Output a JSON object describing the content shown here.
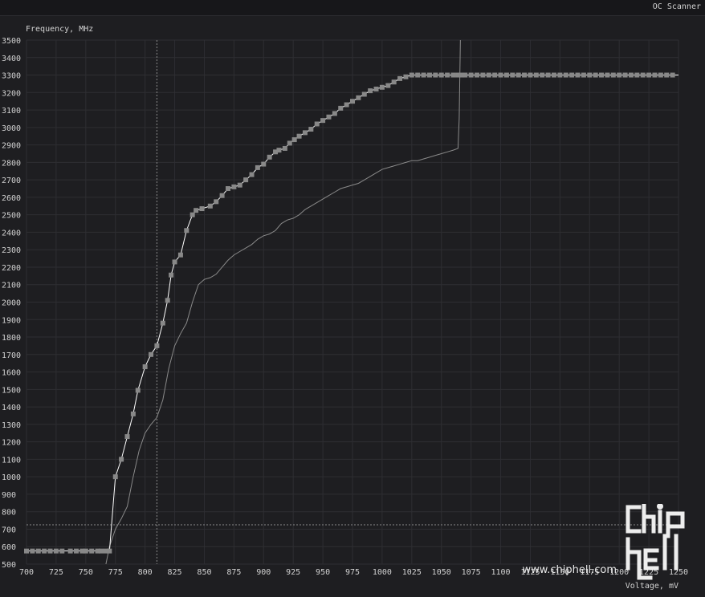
{
  "window": {
    "title": "OC Scanner"
  },
  "watermark": {
    "url": "www.chiphell.com"
  },
  "chart_data": {
    "type": "line",
    "ylabel": "Frequency, MHz",
    "xlabel": "Voltage, mV",
    "xlim": [
      700,
      1250
    ],
    "ylim": [
      500,
      3500
    ],
    "x_ticks": [
      700,
      725,
      750,
      775,
      800,
      825,
      850,
      875,
      900,
      925,
      950,
      975,
      1000,
      1025,
      1050,
      1075,
      1100,
      1125,
      1150,
      1175,
      1200,
      1225,
      1250
    ],
    "y_ticks": [
      500,
      600,
      700,
      800,
      900,
      1000,
      1100,
      1200,
      1300,
      1400,
      1500,
      1600,
      1700,
      1800,
      1900,
      2000,
      2100,
      2200,
      2300,
      2400,
      2500,
      2600,
      2700,
      2800,
      2900,
      3000,
      3100,
      3200,
      3300,
      3400,
      3500
    ],
    "grid": true,
    "crosshair": {
      "x": 810,
      "y": 725
    },
    "colors": {
      "curve": "#ffffff",
      "point": "#888888",
      "baseline": "#8a8a8a",
      "grid": "#2e2e32",
      "text": "#d2d2d2"
    },
    "series": [
      {
        "style": "line-with-markers",
        "x": [
          700,
          705,
          710,
          715,
          720,
          725,
          730,
          737,
          742,
          747,
          750,
          755,
          760,
          763,
          767,
          770,
          775,
          780,
          785,
          790,
          794,
          800,
          805,
          810,
          815,
          819,
          822,
          825,
          830,
          835,
          840,
          843,
          848,
          855,
          860,
          865,
          870,
          875,
          880,
          885,
          890,
          895,
          900,
          905,
          910,
          913,
          918,
          922,
          926,
          930,
          935,
          940,
          945,
          950,
          955,
          960,
          965,
          970,
          975,
          980,
          985,
          990,
          995,
          1000,
          1005,
          1010,
          1015,
          1020,
          1025,
          1030,
          1035,
          1040,
          1045,
          1050,
          1055,
          1060,
          1064,
          1067,
          1070,
          1075,
          1080,
          1085,
          1090,
          1095,
          1100,
          1105,
          1110,
          1115,
          1120,
          1125,
          1130,
          1135,
          1140,
          1145,
          1150,
          1155,
          1160,
          1165,
          1170,
          1175,
          1180,
          1185,
          1190,
          1195,
          1200,
          1205,
          1210,
          1215,
          1220,
          1225,
          1230,
          1235,
          1240,
          1245
        ],
        "y": [
          575,
          575,
          575,
          575,
          575,
          575,
          575,
          575,
          575,
          575,
          575,
          575,
          575,
          575,
          575,
          575,
          1000,
          1100,
          1230,
          1360,
          1495,
          1630,
          1700,
          1750,
          1880,
          2010,
          2155,
          2230,
          2270,
          2410,
          2500,
          2525,
          2535,
          2550,
          2575,
          2610,
          2650,
          2660,
          2670,
          2700,
          2730,
          2770,
          2790,
          2830,
          2860,
          2870,
          2880,
          2910,
          2930,
          2950,
          2970,
          2990,
          3020,
          3040,
          3060,
          3080,
          3110,
          3130,
          3150,
          3170,
          3190,
          3210,
          3220,
          3230,
          3240,
          3260,
          3280,
          3290,
          3300,
          3300,
          3300,
          3300,
          3300,
          3300,
          3300,
          3300,
          3300,
          3300,
          3300,
          3300,
          3300,
          3300,
          3300,
          3300,
          3300,
          3300,
          3300,
          3300,
          3300,
          3300,
          3300,
          3300,
          3300,
          3300,
          3300,
          3300,
          3300,
          3300,
          3300,
          3300,
          3300,
          3300,
          3300,
          3300,
          3300,
          3300,
          3300,
          3300,
          3300,
          3300,
          3300,
          3300,
          3300,
          3300
        ]
      },
      {
        "style": "line",
        "x": [
          767,
          770,
          775,
          780,
          785,
          790,
          795,
          800,
          805,
          810,
          815,
          820,
          825,
          830,
          835,
          840,
          845,
          850,
          855,
          860,
          865,
          870,
          875,
          880,
          885,
          890,
          895,
          900,
          905,
          910,
          915,
          920,
          925,
          930,
          935,
          940,
          945,
          950,
          955,
          960,
          965,
          970,
          975,
          980,
          985,
          990,
          995,
          1000,
          1005,
          1010,
          1015,
          1020,
          1025,
          1030,
          1035,
          1040,
          1045,
          1050,
          1055,
          1060,
          1064,
          1065,
          1066
        ],
        "y": [
          500,
          600,
          700,
          760,
          830,
          1000,
          1150,
          1250,
          1300,
          1340,
          1440,
          1620,
          1750,
          1820,
          1880,
          2000,
          2100,
          2130,
          2140,
          2160,
          2200,
          2240,
          2270,
          2290,
          2310,
          2330,
          2360,
          2380,
          2390,
          2410,
          2450,
          2470,
          2480,
          2500,
          2530,
          2550,
          2570,
          2590,
          2610,
          2630,
          2650,
          2660,
          2670,
          2680,
          2700,
          2720,
          2740,
          2760,
          2770,
          2780,
          2790,
          2800,
          2810,
          2810,
          2820,
          2830,
          2840,
          2850,
          2860,
          2870,
          2880,
          3050,
          3500
        ]
      }
    ]
  }
}
